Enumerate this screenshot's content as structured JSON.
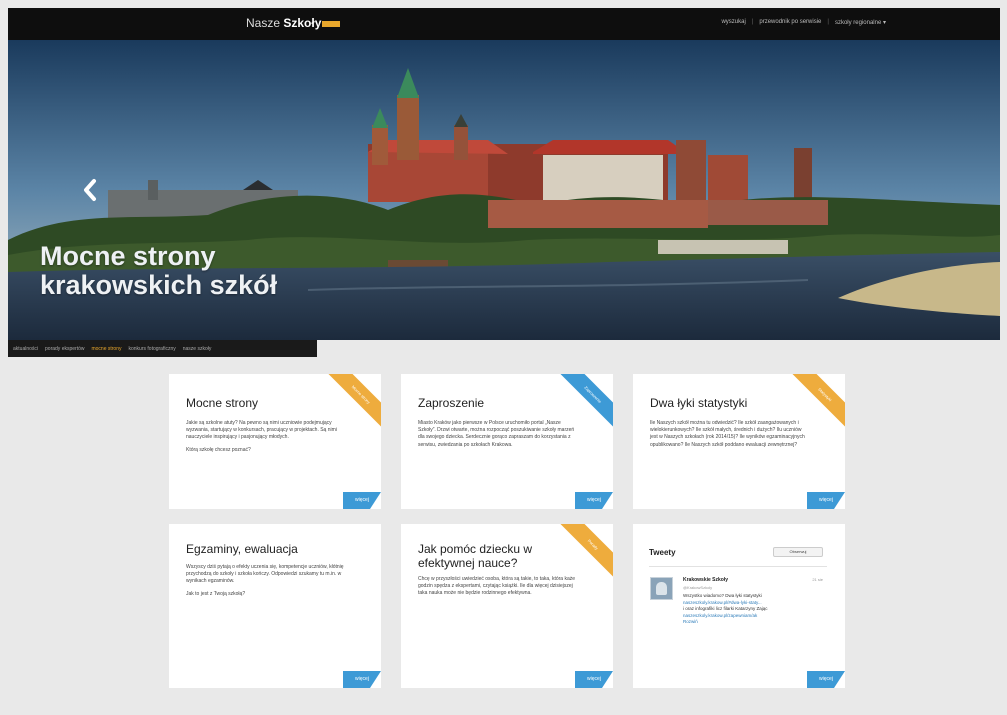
{
  "brand": {
    "light": "Nasze",
    "bold": "Szkoły"
  },
  "topnav": {
    "items": [
      "wyszukaj",
      "przewodnik po serwisie",
      "szkoły regionalne ▾"
    ]
  },
  "hero": {
    "title_line1": "Mocne strony",
    "title_line2": "krakowskich szkół"
  },
  "slider_tabs": [
    "aktualności",
    "porady ekspertów",
    "mocne strony",
    "konkurs fotograficzny",
    "nasze szkoły"
  ],
  "cards": [
    {
      "title": "Mocne strony",
      "paragraphs": [
        "Jakie są szkolne atuty? Na pewno są nimi uczniowie podejmujący wyzwania, startujący w konkursach, pracujący w projektach. Są nimi nauczyciele inspirujący i pasjonujący młodych.",
        "Którą szkołę chcesz poznać?"
      ],
      "ribbon": "Mocne strony",
      "ribbon_color": "#eeac3d",
      "more": "więcej"
    },
    {
      "title": "Zaproszenie",
      "paragraphs": [
        "Miasto Kraków jako pierwsze w Polsce uruchomiło portal „Nasze Szkoły”. Drzwi otwarte, można rozpocząć poszukiwanie szkoły marzeń dla swojego dziecka. Serdecznie gorąco zapraszam do korzystania z serwisu, zwiedzania po szkołach Krakowa."
      ],
      "ribbon": "Zaproszenie",
      "ribbon_color": "#3d9ad6",
      "more": "więcej"
    },
    {
      "title": "Dwa łyki statystyki",
      "paragraphs": [
        "Ile Naszych szkół można tu odwiedzić? Ile szkół zaangażowanych i wielokierunkowych? Ile szkół małych, średnich i dużych? Ilu uczniów jest w Naszych szkołach (rok 2014/15)? Ile wyników egzaminacyjnych opublikowano? Ile Naszych szkół poddano ewaluacji zewnętrznej?"
      ],
      "ribbon": "Statystyki",
      "ribbon_color": "#eeac3d",
      "more": "więcej"
    },
    {
      "title": "Egzaminy, ewaluacja",
      "paragraphs": [
        "Wszyscy dziś pytają o efekty uczenia się, kompetencje uczniów, kłótnię przychodzą do szkoły i szkoła kończy. Odpowiedzi szukamy tu m.in. w wynikach egzaminów.",
        "Jak to jest z Twoją szkołą?"
      ],
      "ribbon": "",
      "ribbon_color": "",
      "more": "więcej"
    },
    {
      "title": "Jak pomóc dziecku w efektywnej nauce?",
      "paragraphs": [
        "Chcę w przyszłości uwiedzieć osoba, która są takie, to taka, która każe godzin spędza z ekspertami, czytając książki. Ile dla więcej dzisiejszej taka nauka może nie będzie rodzinnego efektywna."
      ],
      "ribbon": "Porady",
      "ribbon_color": "#eeac3d",
      "more": "więcej"
    }
  ],
  "tweets": {
    "title": "Tweety",
    "follow": "Obserwuj",
    "name": "Krakowskie Szkoły",
    "handle": "@KrakowSzkoly",
    "time": "21 sie",
    "text": "Wszystko wiadomo? Dwa łyki statystyki",
    "link1": "naszeszkoly.krakow.pl/#dwa-lyki-staty...",
    "text2": "i oraz infografiki licz filarki Katarzyny Zając",
    "link2": "naszeszkoly.krakow.pl/zapewniam/ak",
    "link3": "Rozwiń",
    "more": "więcej"
  },
  "colors": {
    "accent_orange": "#eeac3d",
    "accent_blue": "#3d9ad6",
    "topbar": "#0e0e0e"
  }
}
